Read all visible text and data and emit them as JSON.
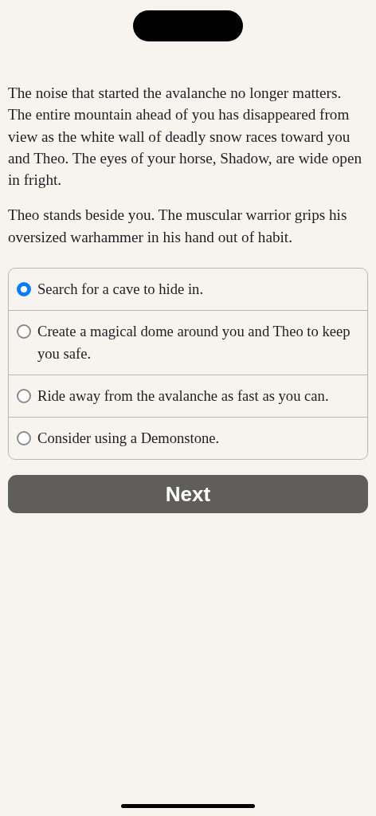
{
  "story": [
    "The noise that started the avalanche no longer matters. The entire mountain ahead of you has disappeared from view as the white wall of deadly snow races toward you and Theo. The eyes of your horse, Shadow, are wide open in fright.",
    "Theo stands beside you. The muscular warrior grips his oversized warhammer in his hand out of habit."
  ],
  "choices": [
    {
      "label": "Search for a cave to hide in.",
      "selected": true
    },
    {
      "label": "Create a magical dome around you and Theo to keep you safe.",
      "selected": false
    },
    {
      "label": "Ride away from the avalanche as fast as you can.",
      "selected": false
    },
    {
      "label": "Consider using a Demonstone.",
      "selected": false
    }
  ],
  "button": "Next"
}
